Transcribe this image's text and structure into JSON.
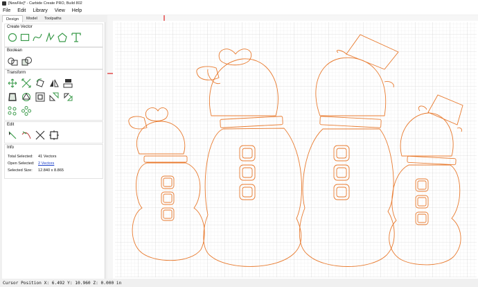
{
  "window": {
    "title": "[NewFile]* - Carbide Create PRO, Build 802"
  },
  "menu": [
    "File",
    "Edit",
    "Library",
    "View",
    "Help"
  ],
  "tabs": [
    "Design",
    "Model",
    "Toolpaths"
  ],
  "active_tab": "Design",
  "sections": {
    "create_vector": {
      "title": "Create Vector",
      "tools": [
        "circle-tool-icon",
        "rectangle-tool-icon",
        "curve-tool-icon",
        "polyline-tool-icon",
        "polygon-tool-icon",
        "text-tool-icon"
      ]
    },
    "boolean": {
      "title": "Boolean",
      "tools": [
        "boolean-union-icon",
        "boolean-subtract-icon"
      ]
    },
    "transform": {
      "title": "Transform",
      "tools": [
        "move-icon",
        "scale-icon",
        "rotate-icon",
        "mirror-icon",
        "offset-icon",
        "align-icon",
        "group-icon",
        "ungroup-icon",
        "array-icon",
        "circular-array-icon"
      ]
    },
    "edit": {
      "title": "Edit",
      "tools": [
        "node-edit-icon",
        "smooth-node-icon",
        "cut-vector-icon",
        "select-all-icon"
      ]
    },
    "info": {
      "title": "Info",
      "total_selected_label": "Total Selected:",
      "total_selected_value": "41 Vectors",
      "open_selected_label": "Open Selected:",
      "open_selected_value": "2 Vectors",
      "selected_size_label": "Selected Size:",
      "selected_size_value": "12.840 x 8.865"
    }
  },
  "status": {
    "cursor_position": "Cursor Position X: 6.492 Y: 10.960 Z: 0.000 in"
  },
  "colors": {
    "vector_stroke": "#e87a2e",
    "grid_minor": "#e6e6e6",
    "grid_major": "#c8c8c8",
    "accent_green": "#3a9a4a",
    "ruler_marker": "#e02020"
  }
}
